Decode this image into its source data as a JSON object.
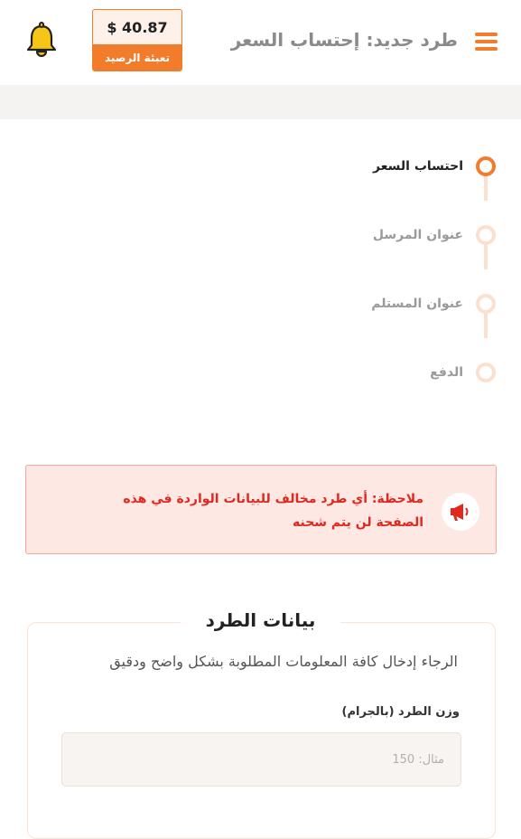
{
  "header": {
    "title": "طرد جديد: إحتساب السعر",
    "balance_amount": "$ 40.87",
    "topup_label": "تعبئة الرصيد",
    "menu_icon": "hamburger-menu-icon",
    "bell_icon": "bell-icon"
  },
  "stepper": {
    "steps": [
      {
        "label": "احتساب السعر",
        "active": true
      },
      {
        "label": "عنوان المرسل",
        "active": false
      },
      {
        "label": "عنوان المستلم",
        "active": false
      },
      {
        "label": "الدفع",
        "active": false
      }
    ]
  },
  "notice": {
    "icon": "megaphone-icon",
    "text": "ملاحظة: أي طرد مخالف للبيانات الواردة في هذه الصفحة لن يتم شحنه"
  },
  "parcel": {
    "title": "بيانات الطرد",
    "subtitle": "الرجاء إدخال كافة المعلومات المطلوبة بشكل واضح ودقيق",
    "weight_label": "وزن الطرد (بالجرام)",
    "weight_placeholder": "مثال: 150",
    "weight_value": ""
  },
  "colors": {
    "accent": "#f07c2c",
    "accent_light": "#fbe0cf",
    "notice_bg": "#fde8e3",
    "notice_text": "#e0281f",
    "bell": "#f5c518"
  }
}
